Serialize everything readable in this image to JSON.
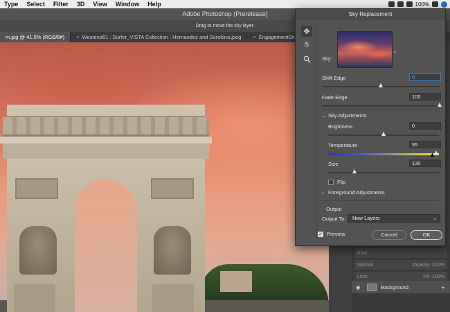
{
  "menubar": {
    "menus": [
      "Type",
      "Select",
      "Filter",
      "3D",
      "View",
      "Window",
      "Help"
    ],
    "battery": "100%",
    "icons": [
      "creative-cloud-icon",
      "dropbox-icon",
      "wifi-icon",
      "battery-icon",
      "user-avatar-icon"
    ]
  },
  "app": {
    "title": "Adobe Photoshop (Prerelease)",
    "options_hint": "Drag to move the sky layer."
  },
  "tabs": [
    {
      "label": "m.jpg @ 41.5% (RGB/8#)",
      "active": true
    },
    {
      "label": "Westend61 : Surfer_VISTA Collection : Hernandez and Sorokina.jpeg",
      "active": false
    },
    {
      "label": "EngagementShootCalex",
      "active": false
    }
  ],
  "dialog": {
    "title": "Sky Replacement",
    "tools": [
      "move-sky-tool",
      "hand-tool",
      "zoom-tool"
    ],
    "sky_label": "Sky:",
    "shift_edge": {
      "label": "Shift Edge",
      "value": "0",
      "level": 0.5
    },
    "fade_edge": {
      "label": "Fade Edge",
      "value": "100",
      "level": 1.0
    },
    "sky_adjustments": {
      "label": "Sky Adjustments",
      "brightness": {
        "label": "Brightness",
        "value": "0",
        "level": 0.5
      },
      "temperature": {
        "label": "Temperature",
        "value": "95",
        "level": 0.975
      },
      "size": {
        "label": "Size",
        "value": "130",
        "level": 0.24
      },
      "flip_label": "Flip"
    },
    "foreground_adjustments": "Foreground Adjustments",
    "output": {
      "section": "Output",
      "output_to_label": "Output To:",
      "output_to_value": "New Layers",
      "preview_label": "Preview"
    },
    "cancel": "Cancel",
    "ok": "OK"
  },
  "layers": {
    "kind_placeholder": "Kind",
    "mode": "Normal",
    "opacity": "Opacity: 100%",
    "lock": "Lock:",
    "fill": "Fill: 100%",
    "background_layer": "Background"
  }
}
